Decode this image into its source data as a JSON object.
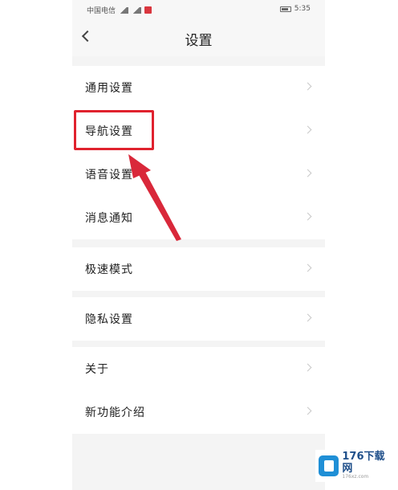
{
  "status_bar": {
    "carrier": "中国电信",
    "time": "5:35"
  },
  "header": {
    "title": "设置"
  },
  "groups": [
    {
      "items": [
        {
          "label": "通用设置"
        },
        {
          "label": "导航设置"
        },
        {
          "label": "语音设置"
        },
        {
          "label": "消息通知"
        }
      ]
    },
    {
      "items": [
        {
          "label": "极速模式"
        }
      ]
    },
    {
      "items": [
        {
          "label": "隐私设置"
        }
      ]
    },
    {
      "items": [
        {
          "label": "关于"
        },
        {
          "label": "新功能介绍"
        }
      ]
    }
  ],
  "watermark": {
    "main": "176下载网",
    "sub": "176xz.com"
  },
  "colors": {
    "highlight": "#e0222e",
    "arrow": "#d9283a",
    "background": "#f4f4f4"
  }
}
